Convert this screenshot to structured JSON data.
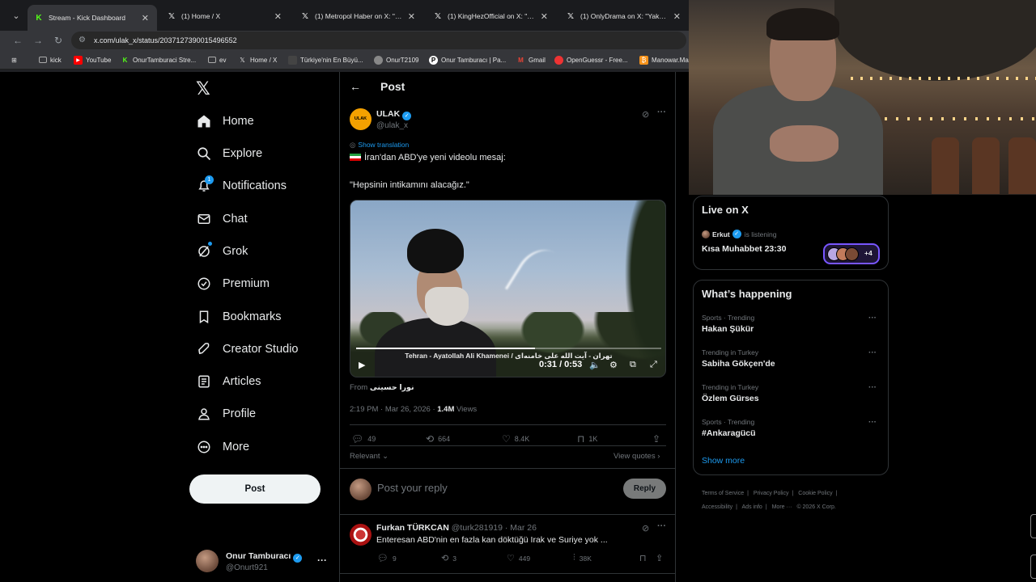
{
  "browser": {
    "tabs": [
      {
        "title": "Stream - Kick Dashboard",
        "favicon": "kick-icon"
      },
      {
        "title": "(1) Home / X",
        "favicon": "x-icon"
      },
      {
        "title": "(1) Metropol Haber on X: \"Zab",
        "favicon": "x-icon"
      },
      {
        "title": "(1) KingHezOfficial on X: \"@Jvn",
        "favicon": "x-icon"
      },
      {
        "title": "(1) OnlyDrama on X: \"YakupTV",
        "favicon": "x-icon"
      }
    ],
    "url": "x.com/ulak_x/status/2037127390015496552",
    "bookmarks": [
      {
        "label": "kick",
        "icon": "folder-icon"
      },
      {
        "label": "YouTube",
        "icon": "youtube-icon"
      },
      {
        "label": "OnurTamburaci Stre...",
        "icon": "kick-icon"
      },
      {
        "label": "ev",
        "icon": "folder-icon"
      },
      {
        "label": "Home / X",
        "icon": "x-icon"
      },
      {
        "label": "Türkiye'nin En Büyü...",
        "icon": "page-icon"
      },
      {
        "label": "OnurT2109",
        "icon": "globe-icon"
      },
      {
        "label": "Onur Tamburacı | Pa...",
        "icon": "p-icon"
      },
      {
        "label": "Gmail",
        "icon": "gmail-icon"
      },
      {
        "label": "OpenGuessr - Free...",
        "icon": "opengeussr-icon"
      },
      {
        "label": "Manowar.Ma",
        "icon": "bitcoin-icon"
      }
    ]
  },
  "nav": {
    "items": [
      {
        "label": "Home",
        "icon": "home-icon"
      },
      {
        "label": "Explore",
        "icon": "search-icon"
      },
      {
        "label": "Notifications",
        "icon": "bell-icon",
        "badge": "1"
      },
      {
        "label": "Chat",
        "icon": "mail-icon"
      },
      {
        "label": "Grok",
        "icon": "grok-icon"
      },
      {
        "label": "Premium",
        "icon": "premium-icon"
      },
      {
        "label": "Bookmarks",
        "icon": "bookmark-icon"
      },
      {
        "label": "Creator Studio",
        "icon": "rocket-icon"
      },
      {
        "label": "Articles",
        "icon": "article-icon"
      },
      {
        "label": "Profile",
        "icon": "person-icon"
      },
      {
        "label": "More",
        "icon": "more-circle-icon"
      }
    ],
    "post_button": "Post",
    "account": {
      "name": "Onur Tamburacı",
      "handle": "@Onurt921"
    }
  },
  "post": {
    "header": "Post",
    "author": {
      "name": "ULAK",
      "handle": "@ulak_x",
      "avatar_text": "ULAK"
    },
    "show_translation": "Show translation",
    "text_line1": "İran'dan ABD'ye yeni videolu mesaj:",
    "text_line2": "\"Hepsinin intikamını alacağız.\"",
    "video": {
      "caption": "Tehran - Ayatollah Ali Khamenei / تهران - آیت الله علی خامنه‌ای",
      "time": "0:31 / 0:53",
      "progress": 0.585
    },
    "source_prefix": "From",
    "source_name": "نورا حسینی",
    "timestamp": "2:19 PM · Mar 26, 2026 · ",
    "views_count": "1.4M",
    "views_label": " Views",
    "actions": {
      "replies": "49",
      "reposts": "664",
      "likes": "8.4K",
      "bookmarks": "1K"
    },
    "sort": "Relevant",
    "view_quotes": "View quotes"
  },
  "reply_box": {
    "placeholder": "Post your reply",
    "button": "Reply"
  },
  "replies": [
    {
      "name": "Furkan TÜRKCAN",
      "meta": "@turk281919 · Mar 26",
      "text": "Enteresan ABD'nin en fazla kan döktüğü Irak ve Suriye yok ...",
      "replies": "9",
      "reposts": "3",
      "likes": "449",
      "views": "38K"
    }
  ],
  "live": {
    "title": "Live on X",
    "host": "Erkut",
    "status": "is listening",
    "space": "Kısa Muhabbet 23:30",
    "extra": "+4"
  },
  "trends": {
    "title": "What’s happening",
    "items": [
      {
        "context": "Sports · Trending",
        "name": "Hakan Şükür"
      },
      {
        "context": "Trending in Turkey",
        "name": "Sabiha Gökçen'de"
      },
      {
        "context": "Trending in Turkey",
        "name": "Özlem Gürses"
      },
      {
        "context": "Sports · Trending",
        "name": "#Ankaragücü"
      }
    ],
    "show_more": "Show more"
  },
  "footer": {
    "links": [
      "Terms of Service",
      "Privacy Policy",
      "Cookie Policy",
      "Accessibility",
      "Ads info",
      "More ···",
      "© 2026 X Corp."
    ]
  },
  "colors": {
    "accent": "#1d9bf0",
    "background": "#000000",
    "muted": "#71767b"
  }
}
